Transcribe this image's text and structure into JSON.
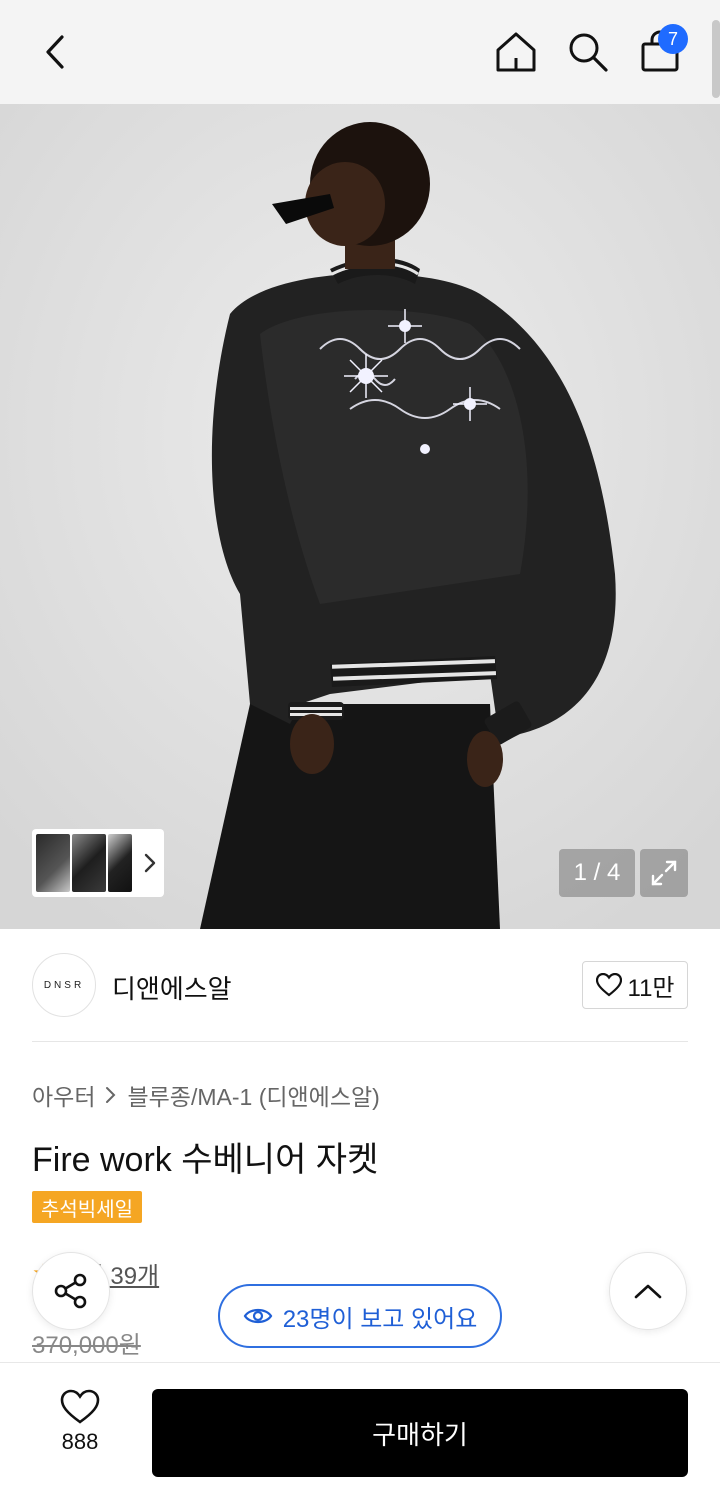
{
  "header": {
    "cart_count": "7"
  },
  "gallery": {
    "counter": "1 / 4"
  },
  "brand": {
    "logo_text": "DNSR",
    "name": "디앤에스알",
    "likes": "11만"
  },
  "product": {
    "breadcrumb": [
      "아우터",
      "블루종/MA-1 (디앤에스알)"
    ],
    "title": "Fire work 수베니어 자켓",
    "badge": "추석빅세일",
    "reviews": "후기 39개",
    "original_price": "370,000원"
  },
  "floating": {
    "viewers": "23명이 보고 있어요"
  },
  "bottom": {
    "wish_count": "888",
    "buy_label": "구매하기"
  },
  "colors": {
    "accent_blue": "#1f6bff",
    "badge_orange": "#f5a623",
    "buy_black": "#000000"
  }
}
